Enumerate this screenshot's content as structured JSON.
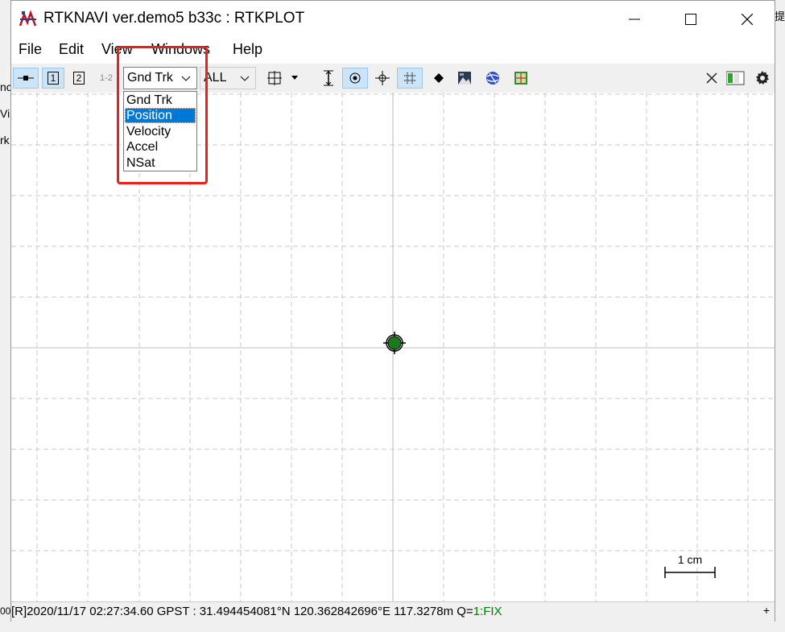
{
  "window": {
    "title": "RTKNAVI ver.demo5 b33c : RTKPLOT"
  },
  "background_fragments": {
    "left": [
      "nc",
      "Vi",
      "rk",
      "00"
    ],
    "right": "提"
  },
  "menu": {
    "items": [
      "File",
      "Edit",
      "View",
      "Windows",
      "Help"
    ]
  },
  "toolbar": {
    "btn_1": "1",
    "btn_2": "2",
    "btn_12": "1-2",
    "plot_type": "Gnd Trk",
    "sat_filter": "ALL"
  },
  "dropdown": {
    "options": [
      "Gnd Trk",
      "Position",
      "Velocity",
      "Accel",
      "NSat"
    ],
    "highlighted": "Position"
  },
  "plot": {
    "scale_label": "1 cm"
  },
  "status": {
    "text": "[R]2020/11/17 02:27:34.60 GPST :  31.494454081°N  120.362842696°E  117.3278m  Q=",
    "quality": "1:FIX",
    "plus": "+"
  },
  "colors": {
    "position_marker": "#1a7a1a",
    "highlight_box": "#e8201e",
    "selection": "#0078d7",
    "fix_status": "#008000"
  }
}
